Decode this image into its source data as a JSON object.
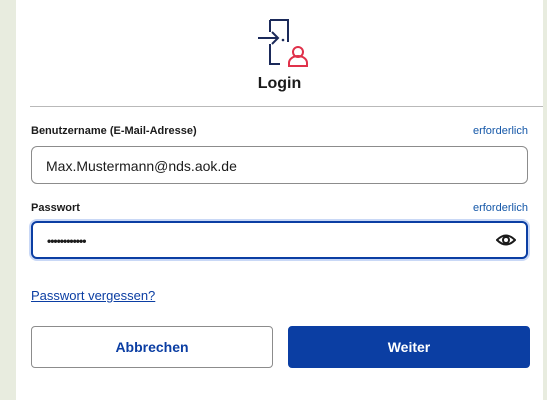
{
  "header": {
    "title": "Login",
    "icon": "door-login-user-icon"
  },
  "form": {
    "username_label": "Benutzername (E-Mail-Adresse)",
    "username_required": "erforderlich",
    "username_value": "Max.Mustermann@nds.aok.de",
    "password_label": "Passwort",
    "password_required": "erforderlich",
    "password_value": "••••••••••••",
    "password_toggle_icon": "eye-icon"
  },
  "links": {
    "forgot_password": "Passwort vergessen?"
  },
  "buttons": {
    "cancel": "Abbrechen",
    "next": "Weiter"
  },
  "colors": {
    "primary": "#0b3ea3",
    "link": "#1457a8",
    "accent_user": "#e0314a",
    "background": "#e8ecdf"
  }
}
